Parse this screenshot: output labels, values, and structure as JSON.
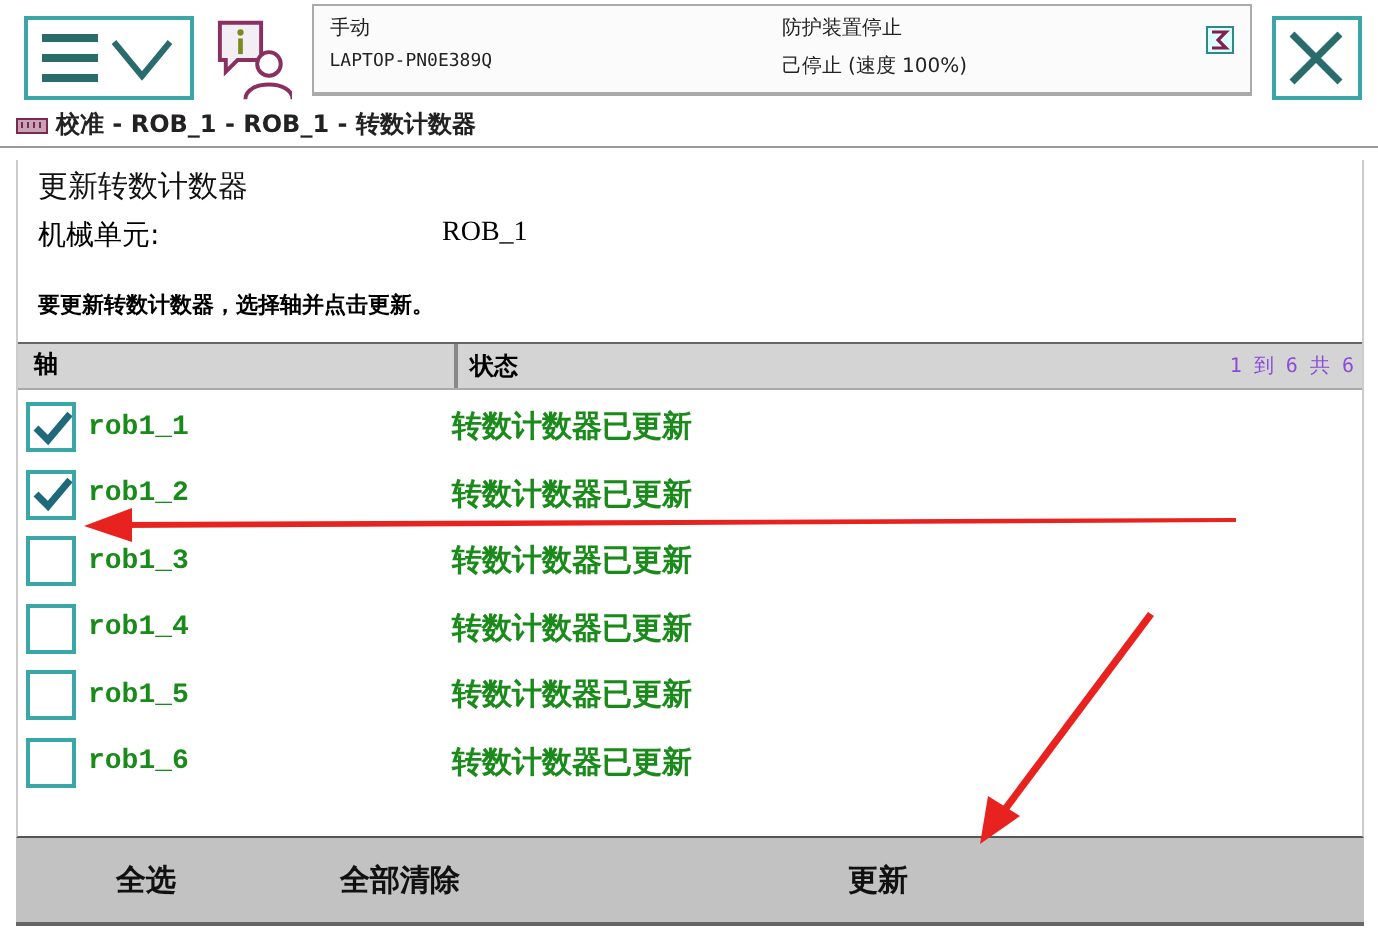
{
  "header": {
    "mode": "手动",
    "controller": "LAPTOP-PN0E389Q",
    "safety_state": "防护装置停止",
    "run_state": "己停止 (速度 100%)"
  },
  "breadcrumb": "校准 - ROB_1 - ROB_1 - 转数计数器",
  "panel": {
    "title": "更新转数计数器",
    "unit_label": "机械单元:",
    "unit_value": "ROB_1",
    "instruction": "要更新转数计数器，选择轴并点击更新。"
  },
  "table": {
    "columns": [
      "轴",
      "状态"
    ],
    "range": "1 到 6 共 6",
    "rows": [
      {
        "axis": "rob1_1",
        "status": "转数计数器已更新",
        "checked": true
      },
      {
        "axis": "rob1_2",
        "status": "转数计数器已更新",
        "checked": true
      },
      {
        "axis": "rob1_3",
        "status": "转数计数器已更新",
        "checked": false
      },
      {
        "axis": "rob1_4",
        "status": "转数计数器已更新",
        "checked": false
      },
      {
        "axis": "rob1_5",
        "status": "转数计数器已更新",
        "checked": false
      },
      {
        "axis": "rob1_6",
        "status": "转数计数器已更新",
        "checked": false
      }
    ]
  },
  "buttons": [
    "全选",
    "全部清除",
    "更新"
  ],
  "annotations": [
    {
      "kind": "arrow"
    },
    {
      "kind": "arrow"
    }
  ]
}
